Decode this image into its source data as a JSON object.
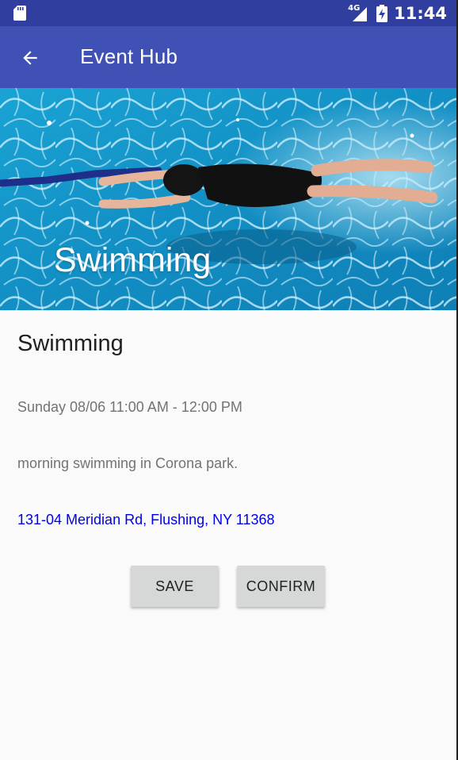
{
  "status_bar": {
    "network": "4G",
    "time": "11:44",
    "icons": [
      "sd-card-icon",
      "signal-icon",
      "battery-charging-icon"
    ]
  },
  "app_bar": {
    "title": "Event Hub",
    "back_icon": "arrow-back-icon"
  },
  "hero": {
    "title": "Swimming",
    "image": "swimmer-in-pool-photo"
  },
  "event": {
    "title": "Swimming",
    "datetime": "Sunday 08/06 11:00 AM - 12:00 PM",
    "description": "morning swimming in Corona park.",
    "address": "131-04 Meridian Rd, Flushing, NY 11368"
  },
  "actions": {
    "save_label": "SAVE",
    "confirm_label": "CONFIRM"
  },
  "colors": {
    "status_bar": "#303f9f",
    "app_bar": "#3f51b5",
    "link": "#0000ee",
    "button": "#d6d7d7"
  }
}
